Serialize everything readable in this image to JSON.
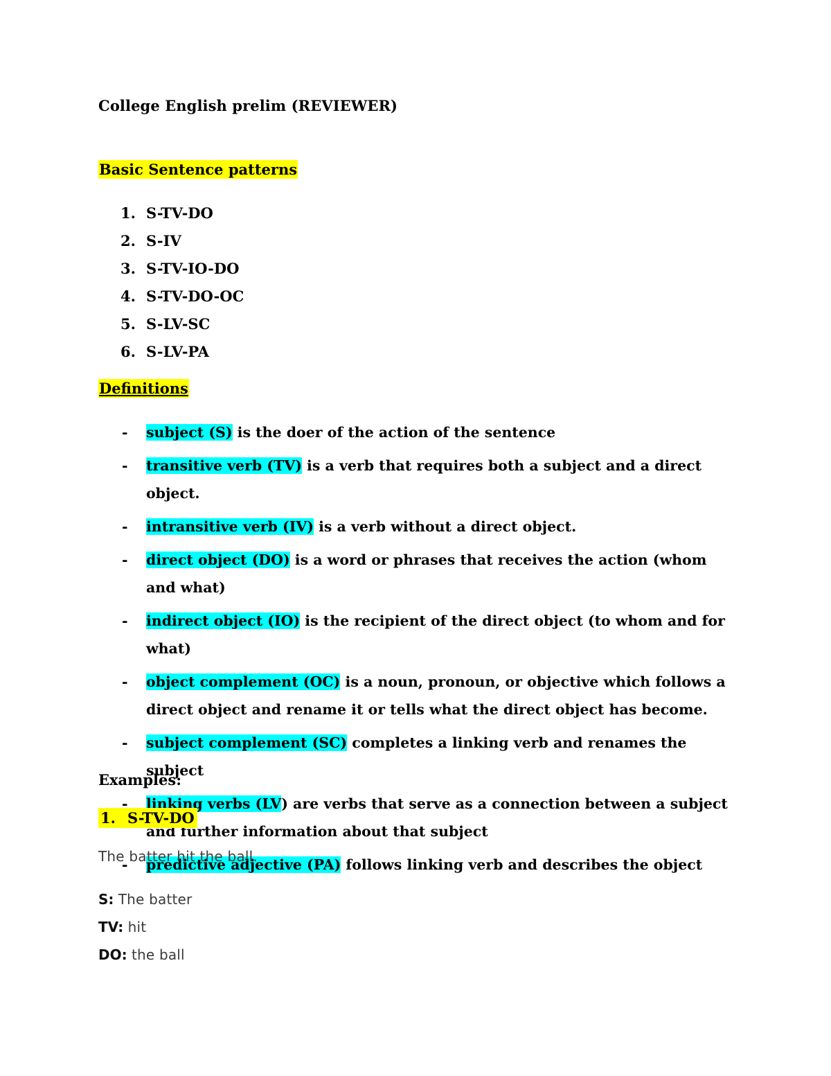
{
  "document": {
    "title": "College English prelim (REVIEWER)",
    "highlight_colors": {
      "yellow": "#FFFF00",
      "cyan": "#00FFFF"
    }
  },
  "sections": {
    "basic_patterns": {
      "heading": "Basic Sentence patterns",
      "items": [
        {
          "num": "1.",
          "text": "S-TV-DO"
        },
        {
          "num": "2.",
          "text": "S-IV"
        },
        {
          "num": "3.",
          "text": "S-TV-IO-DO"
        },
        {
          "num": "4.",
          "text": "S-TV-DO-OC"
        },
        {
          "num": "5.",
          "text": "S-LV-SC"
        },
        {
          "num": "6.",
          "text": "S-LV-PA"
        }
      ]
    },
    "definitions": {
      "heading": "Definitions",
      "bullet": "-",
      "items": [
        {
          "term": "subject (S)",
          "rest": " is the doer of the action of the sentence"
        },
        {
          "term": "transitive verb (TV)",
          "rest": " is a verb that requires both a subject and a direct object."
        },
        {
          "term": "intransitive verb (IV)",
          "rest": " is a verb without a direct object."
        },
        {
          "term": "direct object (DO)",
          "rest": " is a word or phrases that receives the action (whom and what)"
        },
        {
          "term": "indirect object (IO)",
          "rest": " is the recipient of the direct object (to whom and for what)"
        },
        {
          "term": "object complement (OC)",
          "rest": " is a noun, pronoun, or objective which follows a direct object and rename it or tells what the direct object has become."
        },
        {
          "term": "subject complement (SC)",
          "rest": " completes a linking verb and renames the subject"
        },
        {
          "term": "linking verbs (LV",
          "rest": ") are verbs that serve as a connection between a subject and further information about that subject"
        },
        {
          "term": "predictive adjective (PA)",
          "rest": " follows linking verb and describes the object"
        }
      ]
    },
    "examples": {
      "heading": "Examples:",
      "entry": {
        "num": "1.",
        "pattern": "S-TV-DO",
        "sentence": "The batter hit the ball.",
        "breakdown": [
          {
            "label": "S:",
            "value": "The batter"
          },
          {
            "label": "TV:",
            "value": "hit"
          },
          {
            "label": "DO:",
            "value": "the ball"
          }
        ]
      }
    }
  }
}
